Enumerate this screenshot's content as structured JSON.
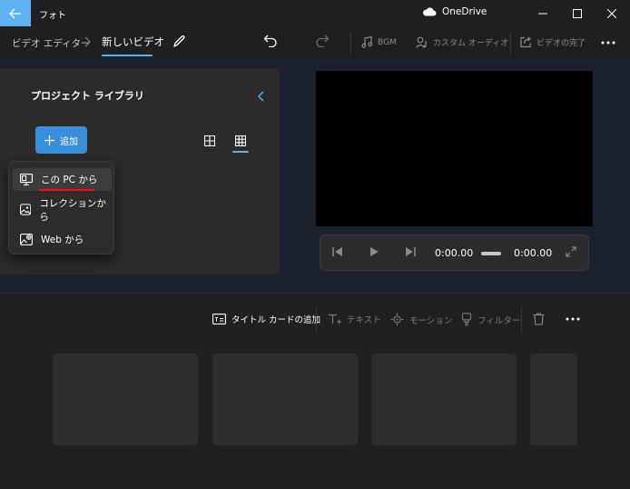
{
  "app": {
    "title": "フォト",
    "cloud_label": "OneDrive"
  },
  "breadcrumb": {
    "root": "ビデオ エディター",
    "current": "新しいビデオ"
  },
  "toolbar": {
    "bgm_label": "BGM",
    "custom_audio_label": "カスタム オーディオ",
    "finish_label": "ビデオの完了"
  },
  "library": {
    "title": "プロジェクト ライブラリ",
    "add_label": "追加"
  },
  "add_menu": {
    "items": [
      {
        "label": "この PC から",
        "icon": "pc-icon"
      },
      {
        "label": "コレクションから",
        "icon": "collection-icon"
      },
      {
        "label": "Web から",
        "icon": "web-image-icon"
      }
    ]
  },
  "playback": {
    "current_time": "0:00.00",
    "total_time": "0:00.00"
  },
  "storyboard": {
    "title_card_label": "タイトル カードの追加",
    "text_label": "テキスト",
    "motion_label": "モーション",
    "filter_label": "フィルター"
  },
  "colors": {
    "accent": "#5fb2f2",
    "add_button": "#3a8fd9",
    "annotation_red": "#e0162b"
  }
}
